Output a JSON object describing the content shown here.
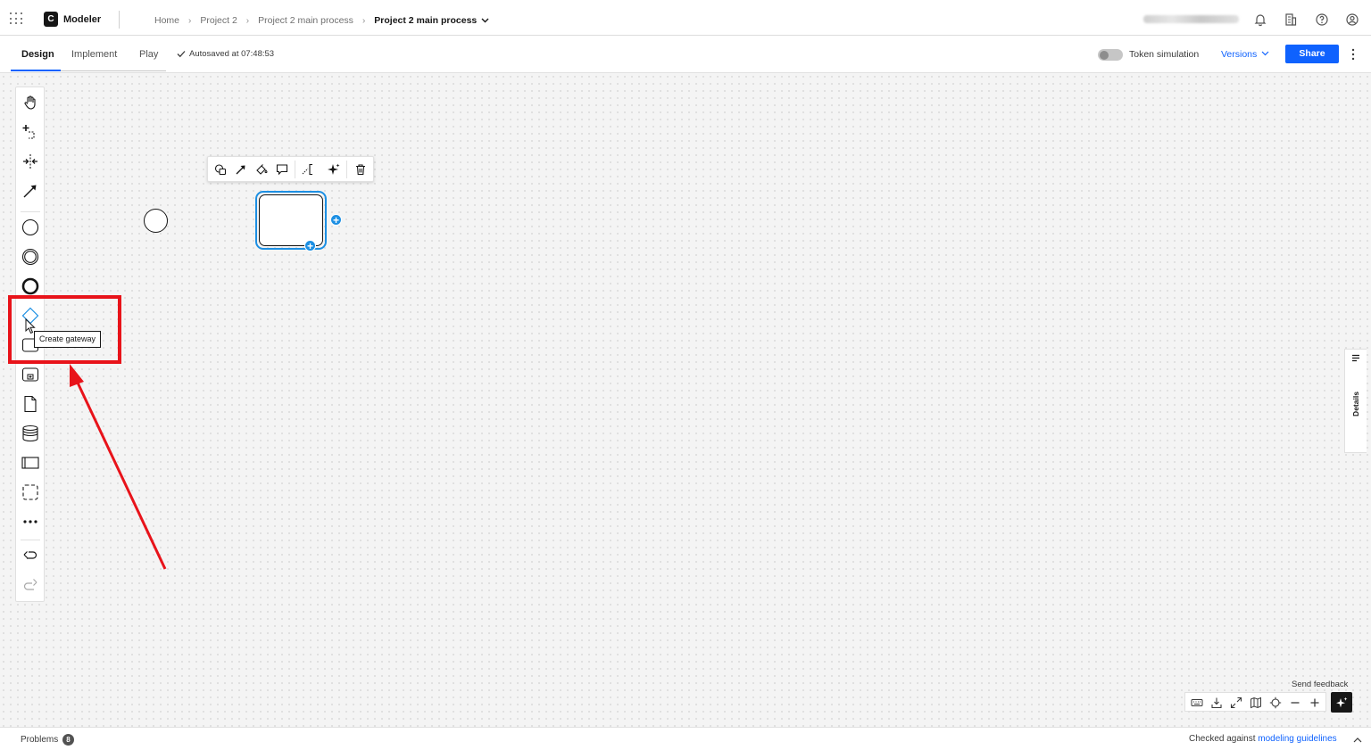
{
  "header": {
    "app_name": "Modeler",
    "logo_letter": "C",
    "breadcrumbs": [
      "Home",
      "Project 2",
      "Project 2 main process",
      "Project 2 main process"
    ],
    "separator": "›",
    "caret": "⌄"
  },
  "subbar": {
    "tabs": [
      "Design",
      "Implement",
      "Play"
    ],
    "autosave": "Autosaved at 07:48:53",
    "token_simulation": "Token simulation",
    "versions": "Versions",
    "share": "Share"
  },
  "palette": {
    "tooltip": "Create gateway",
    "tools": [
      "hand-tool",
      "lasso-tool",
      "space-tool",
      "global-connect-tool",
      "start-event",
      "intermediate-event",
      "end-event",
      "gateway",
      "task",
      "subprocess",
      "data-object",
      "data-store",
      "pool",
      "group",
      "more",
      "undo",
      "redo"
    ]
  },
  "canvas": {
    "feedback": "Send feedback"
  },
  "details": {
    "label": "Details"
  },
  "statusbar": {
    "problems": "Problems",
    "problems_count": "8",
    "checked_prefix": "Checked against ",
    "checked_link": "modeling guidelines"
  },
  "colors": {
    "accent": "#0f62fe",
    "selection": "#1c8fe3",
    "highlight": "#e8131a"
  }
}
